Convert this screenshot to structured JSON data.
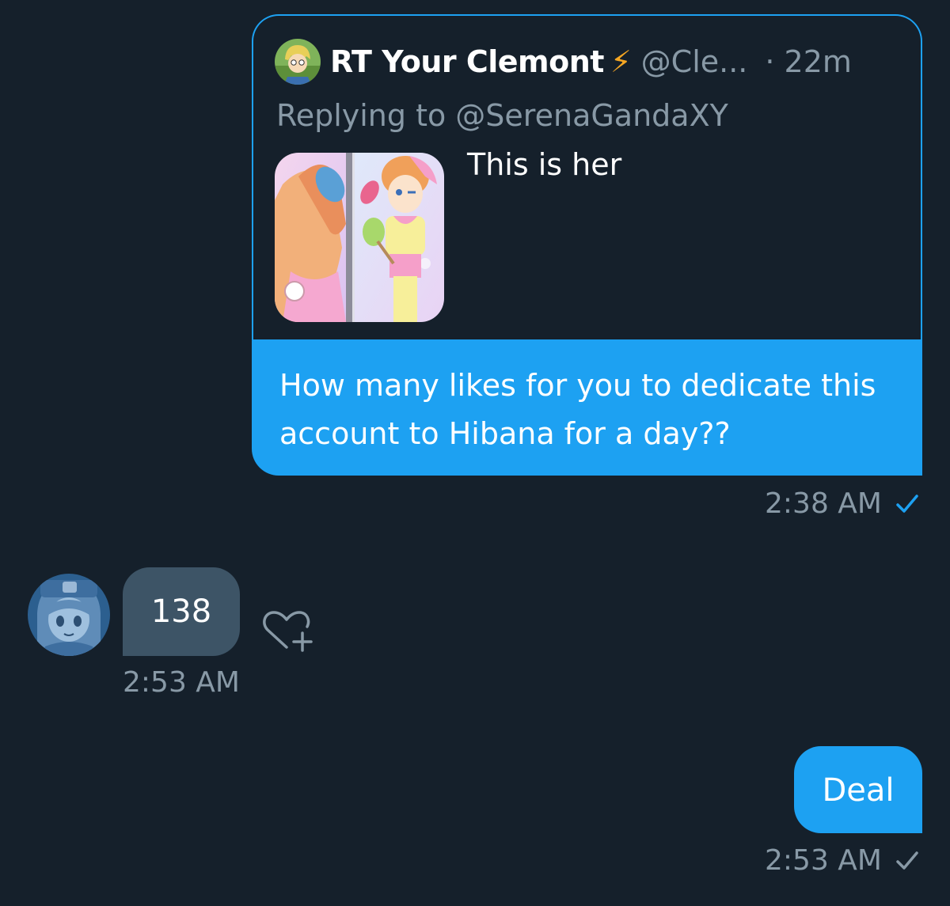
{
  "conversation": {
    "quoted_tweet": {
      "author_name": "RT Your Clemont",
      "author_badge": "⚡",
      "author_handle": "@Cle...",
      "time": "· 22m",
      "replying_to": "Replying to @SerenaGandaXY",
      "text": "This is her",
      "media_icon": "anime-screenshot"
    },
    "messages": [
      {
        "direction": "outgoing",
        "text": "How many likes for you to dedicate this account to Hibana for a day??",
        "time": "2:38 AM",
        "status_icon": "check-icon",
        "status_color": "#1da1f2"
      },
      {
        "direction": "incoming",
        "text": "138",
        "time": "2:53 AM",
        "reaction_icon": "heart-plus-icon"
      },
      {
        "direction": "outgoing",
        "text": "Deal",
        "time": "2:53 AM",
        "status_icon": "check-icon",
        "status_color": "#8899a6"
      }
    ]
  },
  "theme": {
    "background": "#15202b",
    "accent": "#1da1f2",
    "incoming_bubble": "#3d5466",
    "muted_text": "#8899a6",
    "badge_color": "#f5a623"
  }
}
